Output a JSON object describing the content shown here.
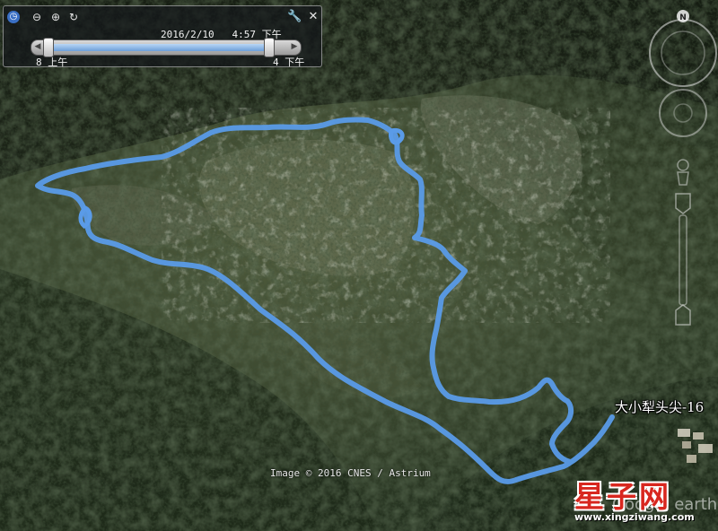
{
  "map": {
    "place_label": "大小犁头尖-16",
    "imagery_credit": "Image © 2016 CNES / Astrium",
    "watermark": "Google earth"
  },
  "time_slider": {
    "date_time": "2016/2/10   4:57 下午",
    "start_label": "8 上午",
    "end_label": "4 下午",
    "position_fraction": 0.93
  },
  "navigation": {
    "north_label": "N"
  },
  "brand": {
    "name": "星子网",
    "url": "www.xingziwang.com",
    "color": "#d8271f"
  },
  "track": {
    "color": "#5a9be8"
  }
}
